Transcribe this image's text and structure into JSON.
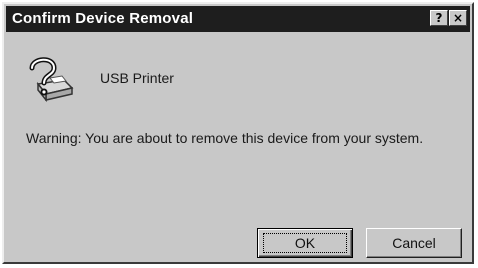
{
  "window": {
    "title": "Confirm Device Removal",
    "help_button": "?",
    "close_button": "×"
  },
  "device": {
    "icon": "question-printer-icon",
    "name": "USB Printer"
  },
  "message": {
    "warning": "Warning: You are about to remove this device from your system."
  },
  "buttons": {
    "ok_label": "OK",
    "cancel_label": "Cancel"
  },
  "colors": {
    "titlebar": "#1e1e1e",
    "title_text": "#ffffff",
    "dialog_face": "#c8c8c8"
  }
}
